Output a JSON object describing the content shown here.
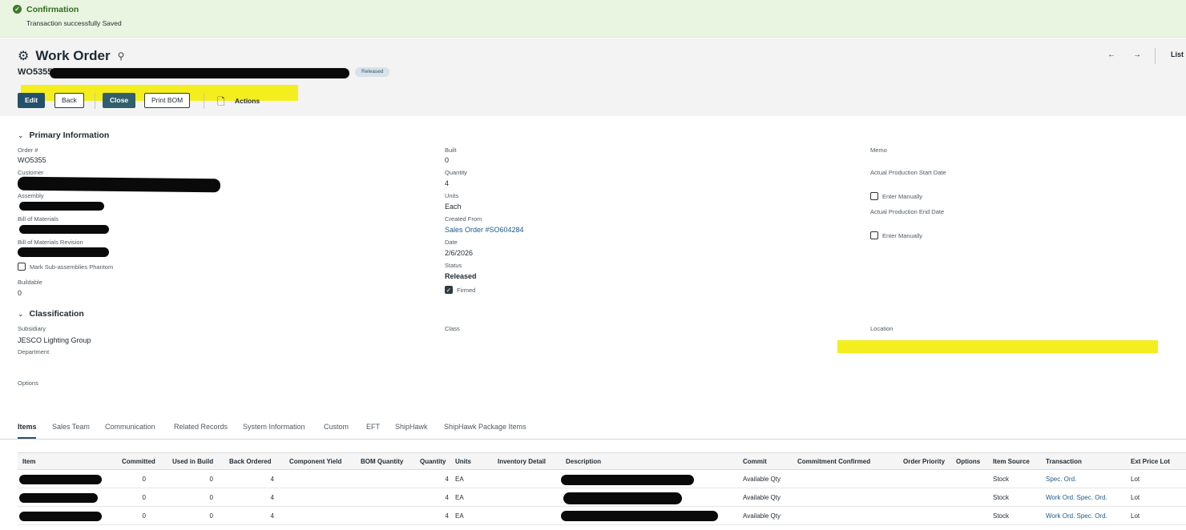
{
  "confirmation": {
    "title": "Confirmation",
    "message": "Transaction successfully Saved"
  },
  "record": {
    "type": "Work Order",
    "id_prefix": "WO5355",
    "status_badge": "Released"
  },
  "toolbar": {
    "edit": "Edit",
    "back": "Back",
    "close": "Close",
    "print_bom": "Print BOM",
    "actions": "Actions"
  },
  "nav": {
    "prev": "←",
    "next": "→",
    "list": "List"
  },
  "primary": {
    "heading": "Primary Information",
    "order_label": "Order #",
    "order_value": "WO5355",
    "customer_label": "Customer",
    "assembly_label": "Assembly",
    "bom_label": "Bill of Materials",
    "bom_rev_label": "Bill of Materials Revision",
    "mark_phantom_label": "Mark Sub-assemblies Phantom",
    "buildable_label": "Buildable",
    "buildable_value": "0",
    "built_label": "Built",
    "built_value": "0",
    "quantity_label": "Quantity",
    "quantity_value": "4",
    "units_label": "Units",
    "units_value": "Each",
    "created_from_label": "Created From",
    "created_from_value": "Sales Order #SO604284",
    "date_label": "Date",
    "date_value": "2/6/2026",
    "status_label": "Status",
    "status_value": "Released",
    "firmed_label": "Firmed",
    "memo_label": "Memo",
    "start_label": "Actual Production Start Date",
    "enter_manually_1": "Enter Manually",
    "end_label": "Actual Production End Date",
    "enter_manually_2": "Enter Manually"
  },
  "classification": {
    "heading": "Classification",
    "subsidiary_label": "Subsidiary",
    "subsidiary_value": "JESCO Lighting Group",
    "department_label": "Department",
    "class_label": "Class",
    "location_label": "Location",
    "options_label": "Options"
  },
  "tabs": [
    "Items",
    "Sales Team",
    "Communication",
    "Related Records",
    "System Information",
    "Custom",
    "EFT",
    "ShipHawk",
    "ShipHawk Package Items"
  ],
  "items_table": {
    "headers": [
      "Item",
      "Committed",
      "Used in Build",
      "Back Ordered",
      "Component Yield",
      "BOM Quantity",
      "Quantity",
      "Units",
      "Inventory Detail",
      "Description",
      "Commit",
      "Commitment Confirmed",
      "Order Priority",
      "Options",
      "Item Source",
      "Transaction",
      "Ext Price Lot"
    ],
    "rows": [
      {
        "committed": "0",
        "used": "0",
        "back": "4",
        "qty": "4",
        "units": "EA",
        "commit": "Available Qty",
        "source": "Stock",
        "txn": "Spec. Ord.",
        "ext": "Lot"
      },
      {
        "committed": "0",
        "used": "0",
        "back": "4",
        "qty": "4",
        "units": "EA",
        "commit": "Available Qty",
        "source": "Stock",
        "txn": "Work Ord.  Spec. Ord.",
        "ext": "Lot"
      },
      {
        "committed": "0",
        "used": "0",
        "back": "4",
        "qty": "4",
        "units": "EA",
        "commit": "Available Qty",
        "source": "Stock",
        "txn": "Work Ord.  Spec. Ord.",
        "ext": "Lot"
      }
    ]
  }
}
